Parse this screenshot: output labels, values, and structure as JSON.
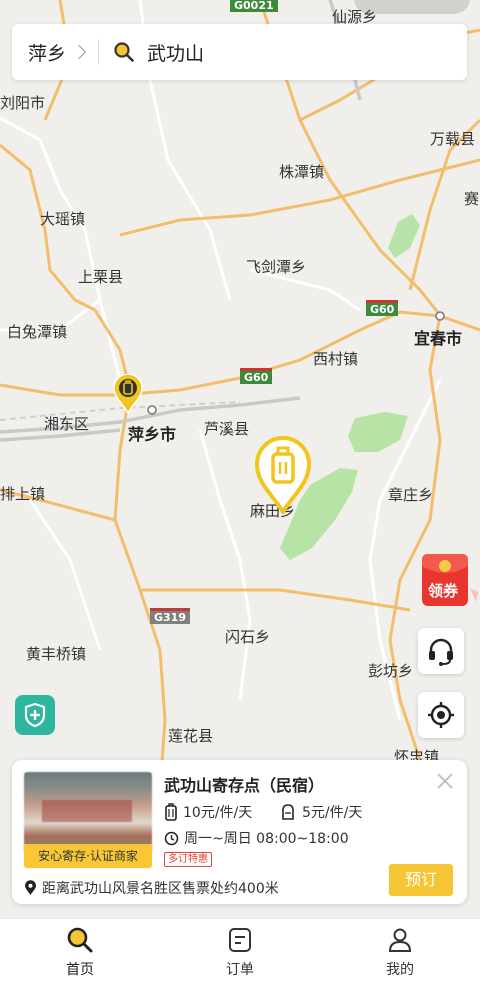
{
  "search": {
    "city": "萍乡",
    "query": "武功山"
  },
  "map": {
    "labels": {
      "liuyang": "刘阳市",
      "wanzai": "万载县",
      "zhutan": "株潭镇",
      "sai": "赛",
      "dayao": "大瑶镇",
      "feijiantan": "飞剑潭乡",
      "shangli": "上栗县",
      "baitutan": "白兔潭镇",
      "xicun": "西村镇",
      "yichun": "宜春市",
      "xiangdong": "湘东区",
      "pingxiang": "萍乡市",
      "luxi": "芦溪县",
      "matian": "麻田乡",
      "zhangzhuang": "章庄乡",
      "paishang": "排上镇",
      "shanshi": "闪石乡",
      "huangfengqiao": "黄丰桥镇",
      "pengfang": "彭坊乡",
      "lianhua": "莲花县",
      "huaizhong": "怀忠镇",
      "xianyuan": "仙源乡"
    },
    "highway_shields": {
      "g60_east": "G60",
      "g60_center": "G60",
      "g319": "G319",
      "g0021": "G0021"
    }
  },
  "store": {
    "name": "武功山寄存点（民宿）",
    "badge": "安心寄存·认证商家",
    "price_large": "10元/件/天",
    "price_small": "5元/件/天",
    "hours": "周一~周日 08:00~18:00",
    "promo": "多订特惠",
    "distance": "距离武功山风景名胜区售票处约400米",
    "book_label": "预订"
  },
  "coupon": {
    "label": "领券"
  },
  "nav": {
    "items": [
      {
        "label": "首页",
        "icon": "search-icon"
      },
      {
        "label": "订单",
        "icon": "order-icon"
      },
      {
        "label": "我的",
        "icon": "profile-icon"
      }
    ]
  },
  "colors": {
    "accent_yellow": "#f5c534",
    "pin_yellow": "#f2c41c",
    "park_green": "#9fd98e",
    "road_orange": "#f2b25a",
    "promo_red": "#e0463c",
    "shield_teal": "#2fb6a0"
  }
}
